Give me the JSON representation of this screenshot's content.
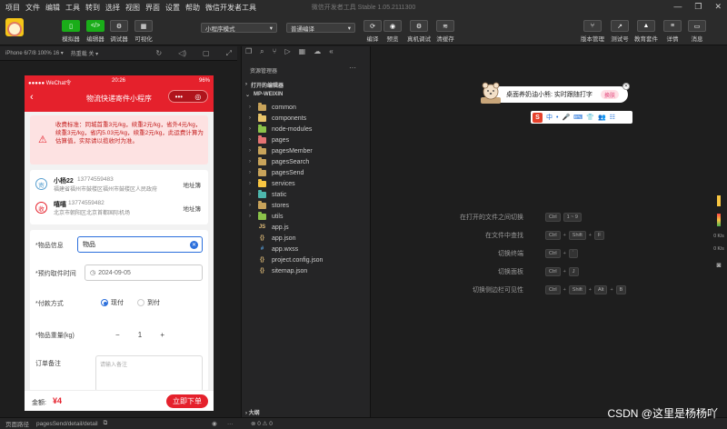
{
  "menubar": {
    "items": [
      "项目",
      "文件",
      "编辑",
      "工具",
      "转到",
      "选择",
      "视图",
      "界面",
      "设置",
      "帮助",
      "微信开发者工具"
    ],
    "window_title": "微信开发者工具 Stable 1.05.2111300"
  },
  "toolbar": {
    "simulator": "模拟器",
    "editor": "编辑器",
    "debugger": "调试器",
    "visual": "可视化",
    "mode_select": "小程序模式",
    "compile_select": "普通编译",
    "compile": "编译",
    "preview": "预览",
    "remote_debug": "真机调试",
    "clear_cache": "清缓存",
    "version": "版本管理",
    "test_account": "测试号",
    "edu": "教育套件",
    "details": "详情",
    "messages": "消息"
  },
  "simulator_header": {
    "device": "iPhone 6/7/8 100% 16 ▾",
    "hotreload": "热重载 关 ▾"
  },
  "phone": {
    "statusbar": {
      "carrier": "●●●●● WeChat令",
      "time": "20:26",
      "battery": "96%"
    },
    "nav_title": "物流快递寄件小程序",
    "notice": "收费标准：同城首重3元/kg，续重2元/kg，省外4元/kg，续重3元/kg，省内5.03元/kg，续重2元/kg，此运费计算为估算值，实际请以揽收时为准。",
    "sender": {
      "badge": "寄",
      "name": "小杨22",
      "phone": "13774559483",
      "address": "福建省福州市鼓楼区福州市鼓楼区人民政府",
      "book": "地址簿"
    },
    "receiver": {
      "badge": "收",
      "name": "嘻嘻",
      "phone": "13774559482",
      "address": "北京市朝阳区北京首都国际机场",
      "book": "地址簿"
    },
    "form": {
      "item_label": "*物品信息",
      "item_value": "物品",
      "pickup_label": "*预约取件时间",
      "pickup_value": "2024-09-05",
      "pay_label": "*付款方式",
      "pay_now": "现付",
      "pay_arrive": "到付",
      "weight_label": "*物品重量(kg)",
      "weight_minus": "−",
      "weight_value": "1",
      "weight_plus": "+",
      "notes_label": "订单备注",
      "notes_placeholder": "请输入备注"
    },
    "footer": {
      "amount_label": "金额:",
      "amount": "¥4",
      "submit": "立即下单"
    }
  },
  "explorer": {
    "title": "资源管理器",
    "more": "···",
    "open_editors": "打开的编辑器",
    "project": "MP-WEIXIN",
    "items": [
      {
        "name": "common",
        "kind": "folder",
        "color": "#c8a35a"
      },
      {
        "name": "components",
        "kind": "folder",
        "color": "#e8c46a"
      },
      {
        "name": "node-modules",
        "kind": "folder",
        "color": "#8bc34a"
      },
      {
        "name": "pages",
        "kind": "folder",
        "color": "#e57373"
      },
      {
        "name": "pagesMember",
        "kind": "folder",
        "color": "#c8a35a"
      },
      {
        "name": "pagesSearch",
        "kind": "folder",
        "color": "#c8a35a"
      },
      {
        "name": "pagesSend",
        "kind": "folder",
        "color": "#c8a35a"
      },
      {
        "name": "services",
        "kind": "folder",
        "color": "#f9c642"
      },
      {
        "name": "static",
        "kind": "folder",
        "color": "#4db6ac"
      },
      {
        "name": "stores",
        "kind": "folder",
        "color": "#c8a35a"
      },
      {
        "name": "utils",
        "kind": "folder",
        "color": "#8bc34a"
      },
      {
        "name": "app.js",
        "kind": "js",
        "glyph": "JS",
        "color": "#e5c07b"
      },
      {
        "name": "app.json",
        "kind": "json",
        "glyph": "{}",
        "color": "#e5c07b"
      },
      {
        "name": "app.wxss",
        "kind": "wxss",
        "glyph": "#",
        "color": "#569cd6"
      },
      {
        "name": "project.config.json",
        "kind": "json",
        "glyph": "{}",
        "color": "#e5c07b"
      },
      {
        "name": "sitemap.json",
        "kind": "json",
        "glyph": "{}",
        "color": "#e5c07b"
      }
    ],
    "outline": "大纲"
  },
  "editor": {
    "popup_text": "桌面养奶油小熊: 实时跟随打字",
    "popup_button": "换肤",
    "ime_items": [
      "中",
      "•",
      "🎤",
      "⌨",
      "👕",
      "👥",
      "☷"
    ],
    "shortcuts": [
      {
        "label": "在打开的文件之间切换",
        "keys": [
          "Ctrl",
          "1 ~ 9"
        ]
      },
      {
        "label": "在文件中查找",
        "keys": [
          "Ctrl",
          "+",
          "Shift",
          "+",
          "F"
        ]
      },
      {
        "label": "切换终端",
        "keys": [
          "Ctrl",
          "+",
          "`"
        ]
      },
      {
        "label": "切换面板",
        "keys": [
          "Ctrl",
          "+",
          "J"
        ]
      },
      {
        "label": "切换侧边栏可见性",
        "keys": [
          "Ctrl",
          "+",
          "Shift",
          "+",
          "Alt",
          "+",
          "B"
        ]
      }
    ]
  },
  "rightstrip": {
    "up": "0 K/s",
    "down": "0 K/s"
  },
  "statusbar": {
    "path_label": "页面路径",
    "path": "pagesSend/detail/detail",
    "errors": "⊗ 0 ⚠ 0"
  },
  "watermark": "CSDN @这里是杨杨吖"
}
